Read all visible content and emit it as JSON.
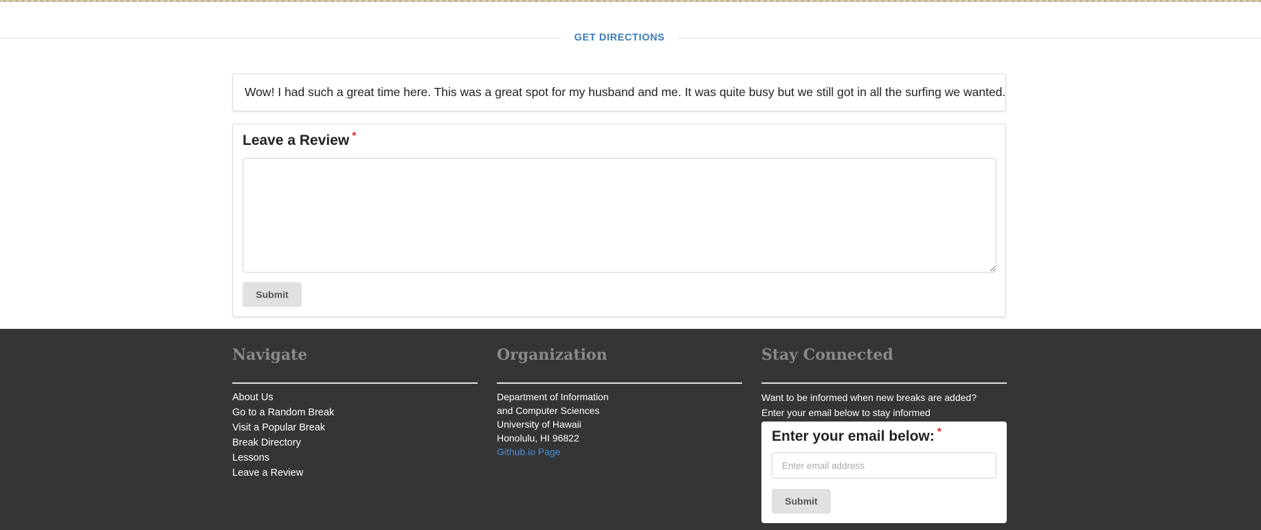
{
  "directions": {
    "label": "GET DIRECTIONS"
  },
  "comment": {
    "text": "Wow! I had such a great time here. This was a great spot for my husband and me. It was quite busy but we still got in all the surfing we wanted."
  },
  "review_form": {
    "label": "Leave a Review",
    "required_mark": "*",
    "textarea_value": "",
    "submit_label": "Submit"
  },
  "footer": {
    "navigate": {
      "heading": "Navigate",
      "links": [
        "About Us",
        "Go to a Random Break",
        "Visit a Popular Break",
        "Break Directory",
        "Lessons",
        "Leave a Review"
      ]
    },
    "organization": {
      "heading": "Organization",
      "lines": [
        "Department of Information",
        "and Computer Sciences",
        "University of Hawaii",
        "Honolulu, HI 96822"
      ],
      "link_label": "Github.io Page"
    },
    "stay_connected": {
      "heading": "Stay Connected",
      "line1": "Want to be informed when new breaks are added?",
      "line2": "Enter your email below to stay informed",
      "email_label": "Enter your email below:",
      "required_mark": "*",
      "email_placeholder": "Enter email address",
      "submit_label": "Submit"
    }
  },
  "colors": {
    "accent_link": "#3b7bbf",
    "footer_bg": "#353535",
    "required": "#db2828",
    "button_bg": "#e0e1e2"
  }
}
